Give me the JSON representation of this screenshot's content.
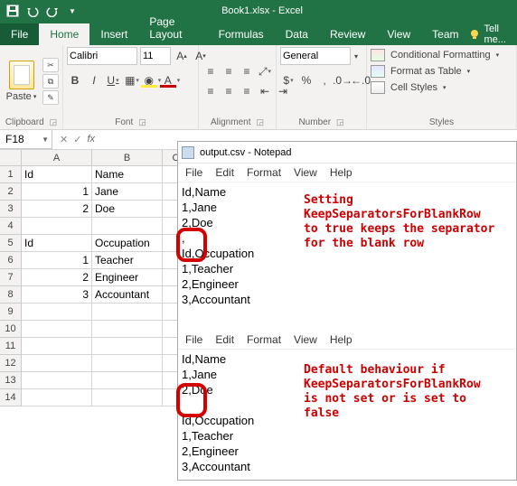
{
  "titlebar": {
    "title": "Book1.xlsx - Excel"
  },
  "qat": {
    "save": "save-icon",
    "undo": "undo-icon",
    "redo": "redo-icon"
  },
  "tabs": {
    "file": "File",
    "home": "Home",
    "insert": "Insert",
    "pagelayout": "Page Layout",
    "formulas": "Formulas",
    "data": "Data",
    "review": "Review",
    "view": "View",
    "team": "Team",
    "tellme": "Tell me..."
  },
  "ribbon": {
    "clipboard": {
      "label": "Clipboard",
      "paste": "Paste"
    },
    "font": {
      "label": "Font",
      "name": "Calibri",
      "size": "11",
      "bold": "B",
      "italic": "I",
      "under": "U",
      "fontcolor": "A"
    },
    "alignment": {
      "label": "Alignment"
    },
    "number": {
      "label": "Number",
      "format": "General",
      "dollar": "$",
      "percent": "%",
      "comma": ","
    },
    "styles": {
      "label": "Styles",
      "cond": "Conditional Formatting",
      "table": "Format as Table",
      "cell": "Cell Styles"
    }
  },
  "namebox": {
    "ref": "F18",
    "fx": "fx"
  },
  "sheet": {
    "cols": [
      "A",
      "B",
      "C"
    ],
    "rows": [
      [
        "Id",
        "Name",
        ""
      ],
      [
        "1",
        "Jane",
        ""
      ],
      [
        "2",
        "Doe",
        ""
      ],
      [
        "",
        "",
        ""
      ],
      [
        "Id",
        "Occupation",
        ""
      ],
      [
        "1",
        "Teacher",
        ""
      ],
      [
        "2",
        "Engineer",
        ""
      ],
      [
        "3",
        "Accountant",
        ""
      ],
      [
        "",
        "",
        ""
      ],
      [
        "",
        "",
        ""
      ],
      [
        "",
        "",
        ""
      ],
      [
        "",
        "",
        ""
      ],
      [
        "",
        "",
        ""
      ],
      [
        "",
        "",
        ""
      ]
    ]
  },
  "notepad": {
    "title": "output.csv - Notepad",
    "menu": [
      "File",
      "Edit",
      "Format",
      "View",
      "Help"
    ],
    "body1": "Id,Name\n1,Jane\n2,Doe\n,\nId,Occupation\n1,Teacher\n2,Engineer\n3,Accountant",
    "body2": "Id,Name\n1,Jane\n2,Doe\n\nId,Occupation\n1,Teacher\n2,Engineer\n3,Accountant"
  },
  "annotations": {
    "a1": "Setting\nKeepSeparatorsForBlankRow\nto true keeps the separator\nfor the blank row",
    "a2": "Default behaviour if\nKeepSeparatorsForBlankRow\nis not set or is set to\nfalse"
  }
}
